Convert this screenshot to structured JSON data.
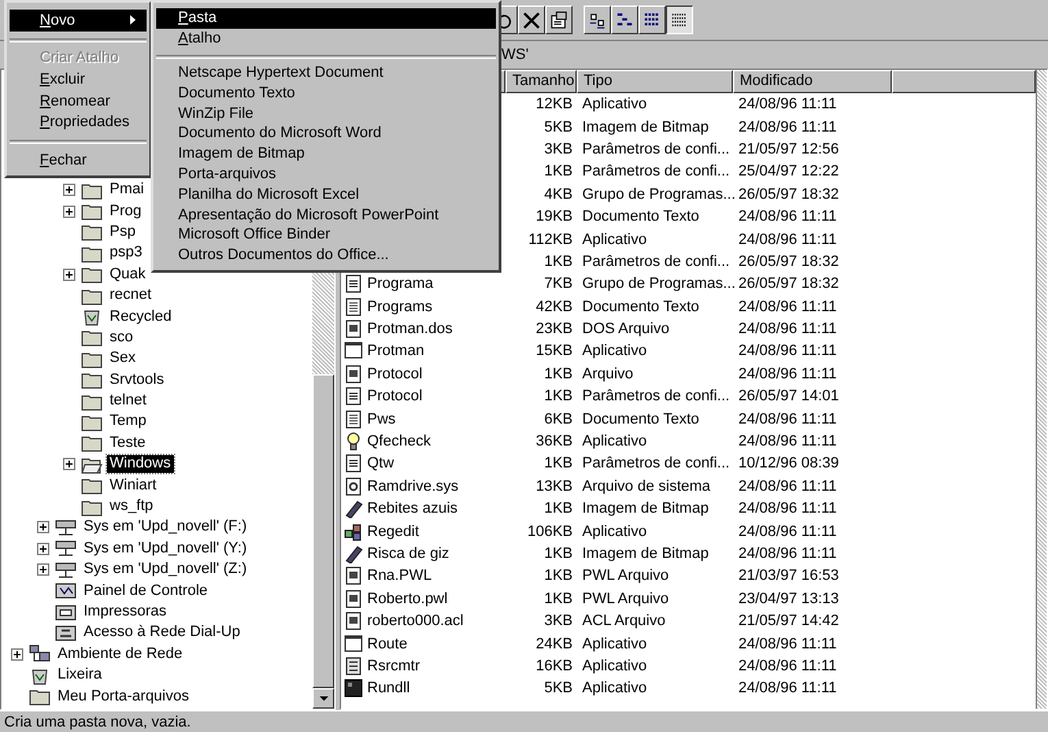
{
  "toolbar": {
    "buttons": [
      {
        "kind": "undo",
        "selected": false
      },
      {
        "kind": "delete",
        "selected": false
      },
      {
        "kind": "properties",
        "selected": false
      }
    ],
    "view_buttons": [
      {
        "kind": "large-icons",
        "selected": false
      },
      {
        "kind": "small-icons",
        "selected": false
      },
      {
        "kind": "list",
        "selected": false
      },
      {
        "kind": "details",
        "selected": true
      }
    ]
  },
  "caption": "WS'",
  "tree": [
    {
      "children": [
        {
          "children": [
            {
              "label": "Pmai",
              "kind": "folder",
              "expandable": true,
              "selected": false
            },
            {
              "label": "Prog",
              "kind": "folder",
              "expandable": true,
              "selected": false
            },
            {
              "label": "Psp",
              "kind": "folder",
              "expandable": false,
              "selected": false
            },
            {
              "label": "psp3",
              "kind": "folder",
              "expandable": false,
              "selected": false
            },
            {
              "label": "Quak",
              "kind": "folder",
              "expandable": true,
              "selected": false
            },
            {
              "label": "recnet",
              "kind": "folder",
              "expandable": false,
              "selected": false
            },
            {
              "label": "Recycled",
              "kind": "recycle",
              "expandable": false,
              "selected": false
            },
            {
              "label": "sco",
              "kind": "folder",
              "expandable": false,
              "selected": false
            },
            {
              "label": "Sex",
              "kind": "folder",
              "expandable": false,
              "selected": false
            },
            {
              "label": "Srvtools",
              "kind": "folder",
              "expandable": false,
              "selected": false
            },
            {
              "label": "telnet",
              "kind": "folder",
              "expandable": false,
              "selected": false
            },
            {
              "label": "Temp",
              "kind": "folder",
              "expandable": false,
              "selected": false
            },
            {
              "label": "Teste",
              "kind": "folder",
              "expandable": false,
              "selected": false
            },
            {
              "label": "Windows",
              "kind": "folder-open",
              "expandable": true,
              "selected": true
            },
            {
              "label": "Winiart",
              "kind": "folder",
              "expandable": false,
              "selected": false
            },
            {
              "label": "ws_ftp",
              "kind": "folder",
              "expandable": false,
              "selected": false
            }
          ]
        },
        {
          "label": "Sys em 'Upd_novell' (F:)",
          "kind": "netdrive",
          "expandable": true,
          "selected": false
        },
        {
          "label": "Sys em 'Upd_novell' (Y:)",
          "kind": "netdrive",
          "expandable": true,
          "selected": false
        },
        {
          "label": "Sys em 'Upd_novell' (Z:)",
          "kind": "netdrive",
          "expandable": true,
          "selected": false
        },
        {
          "label": "Painel de Controle",
          "kind": "panel",
          "expandable": false,
          "selected": false
        },
        {
          "label": "Impressoras",
          "kind": "printer",
          "expandable": false,
          "selected": false
        },
        {
          "label": "Acesso à Rede Dial-Up",
          "kind": "dialup",
          "expandable": false,
          "selected": false
        }
      ]
    },
    {
      "label": "Ambiente de Rede",
      "kind": "network",
      "expandable": true,
      "selected": false
    },
    {
      "label": "Lixeira",
      "kind": "recycle",
      "expandable": false,
      "selected": false
    },
    {
      "label": "Meu Porta-arquivos",
      "kind": "folder",
      "expandable": false,
      "selected": false
    }
  ],
  "columns": [
    "Tamanho",
    "Tipo",
    "Modificado"
  ],
  "rows": [
    {
      "size": "12KB",
      "type": "Aplicativo",
      "modified": "24/08/96 11:11"
    },
    {
      "size": "5KB",
      "type": "Imagem de Bitmap",
      "modified": "24/08/96 11:11"
    },
    {
      "size": "3KB",
      "type": "Parâmetros de confi...",
      "modified": "21/05/97 12:56"
    },
    {
      "size": "1KB",
      "type": "Parâmetros de confi...",
      "modified": "25/04/97 12:22"
    },
    {
      "size": "4KB",
      "type": "Grupo de Programas...",
      "modified": "26/05/97 18:32"
    },
    {
      "size": "19KB",
      "type": "Documento Texto",
      "modified": "24/08/96 11:11"
    },
    {
      "size": "112KB",
      "type": "Aplicativo",
      "modified": "24/08/96 11:11"
    },
    {
      "size": "1KB",
      "type": "Parâmetros de confi...",
      "modified": "26/05/97 18:32"
    },
    {
      "name": "Programa",
      "kind": "config",
      "size": "7KB",
      "type": "Grupo de Programas...",
      "modified": "26/05/97 18:32"
    },
    {
      "name": "Programs",
      "kind": "text",
      "size": "42KB",
      "type": "Documento Texto",
      "modified": "24/08/96 11:11"
    },
    {
      "name": "Protman.dos",
      "kind": "file",
      "size": "23KB",
      "type": "DOS Arquivo",
      "modified": "24/08/96 11:11"
    },
    {
      "name": "Protman",
      "kind": "window",
      "size": "15KB",
      "type": "Aplicativo",
      "modified": "24/08/96 11:11"
    },
    {
      "name": "Protocol",
      "kind": "file",
      "size": "1KB",
      "type": "Arquivo",
      "modified": "24/08/96 11:11"
    },
    {
      "name": "Protocol",
      "kind": "config",
      "size": "1KB",
      "type": "Parâmetros de confi...",
      "modified": "26/05/97 14:01"
    },
    {
      "name": "Pws",
      "kind": "text",
      "size": "6KB",
      "type": "Documento Texto",
      "modified": "24/08/96 11:11"
    },
    {
      "name": "Qfecheck",
      "kind": "bulb",
      "size": "36KB",
      "type": "Aplicativo",
      "modified": "24/08/96 11:11"
    },
    {
      "name": "Qtw",
      "kind": "config",
      "size": "1KB",
      "type": "Parâmetros de confi...",
      "modified": "10/12/96 08:39"
    },
    {
      "name": "Ramdrive.sys",
      "kind": "system",
      "size": "13KB",
      "type": "Arquivo de sistema",
      "modified": "24/08/96 11:11"
    },
    {
      "name": "Rebites azuis",
      "kind": "paint",
      "size": "1KB",
      "type": "Imagem de Bitmap",
      "modified": "24/08/96 11:11"
    },
    {
      "name": "Regedit",
      "kind": "regedit",
      "size": "106KB",
      "type": "Aplicativo",
      "modified": "24/08/96 11:11"
    },
    {
      "name": "Risca de giz",
      "kind": "paint",
      "size": "1KB",
      "type": "Imagem de Bitmap",
      "modified": "24/08/96 11:11"
    },
    {
      "name": "Rna.PWL",
      "kind": "file",
      "size": "1KB",
      "type": "PWL Arquivo",
      "modified": "21/03/97 16:53"
    },
    {
      "name": "Roberto.pwl",
      "kind": "file",
      "size": "1KB",
      "type": "PWL Arquivo",
      "modified": "23/04/97 13:13"
    },
    {
      "name": "roberto000.acl",
      "kind": "file",
      "size": "3KB",
      "type": "ACL Arquivo",
      "modified": "21/05/97 14:42"
    },
    {
      "name": "Route",
      "kind": "window",
      "size": "24KB",
      "type": "Aplicativo",
      "modified": "24/08/96 11:11"
    },
    {
      "name": "Rsrcmtr",
      "kind": "listwin",
      "size": "16KB",
      "type": "Aplicativo",
      "modified": "24/08/96 11:11"
    },
    {
      "name": "Rundll",
      "kind": "dark",
      "size": "5KB",
      "type": "Aplicativo",
      "modified": "24/08/96 11:11"
    }
  ],
  "status_bar": "Cria uma pasta nova, vazia.",
  "file_menu": [
    {
      "kind": "item",
      "label": "Novo",
      "mnemonic": true,
      "has_submenu": true,
      "selected": true,
      "disabled": false
    },
    {
      "kind": "separator"
    },
    {
      "kind": "item",
      "label": "Criar Atalho",
      "mnemonic": false,
      "has_submenu": false,
      "selected": false,
      "disabled": true
    },
    {
      "kind": "item",
      "label": "Excluir",
      "mnemonic": true,
      "has_submenu": false,
      "selected": false,
      "disabled": false
    },
    {
      "kind": "item",
      "label": "Renomear",
      "mnemonic": true,
      "has_submenu": false,
      "selected": false,
      "disabled": false
    },
    {
      "kind": "item",
      "label": "Propriedades",
      "mnemonic": true,
      "has_submenu": false,
      "selected": false,
      "disabled": false
    },
    {
      "kind": "separator"
    },
    {
      "kind": "item",
      "label": "Fechar",
      "mnemonic": true,
      "has_submenu": false,
      "selected": false,
      "disabled": false
    }
  ],
  "new_submenu": [
    {
      "kind": "item",
      "label": "Pasta",
      "mnemonic": true,
      "selected": true
    },
    {
      "kind": "item",
      "label": "Atalho",
      "mnemonic": true,
      "selected": false
    },
    {
      "kind": "separator"
    },
    {
      "kind": "item",
      "label": "Netscape Hypertext Document",
      "mnemonic": false,
      "selected": false
    },
    {
      "kind": "item",
      "label": "Documento Texto",
      "mnemonic": false,
      "selected": false
    },
    {
      "kind": "item",
      "label": "WinZip File",
      "mnemonic": false,
      "selected": false
    },
    {
      "kind": "item",
      "label": "Documento do Microsoft Word",
      "mnemonic": false,
      "selected": false
    },
    {
      "kind": "item",
      "label": "Imagem de Bitmap",
      "mnemonic": false,
      "selected": false
    },
    {
      "kind": "item",
      "label": "Porta-arquivos",
      "mnemonic": false,
      "selected": false
    },
    {
      "kind": "item",
      "label": "Planilha do Microsoft Excel",
      "mnemonic": false,
      "selected": false
    },
    {
      "kind": "item",
      "label": "Apresentação do Microsoft PowerPoint",
      "mnemonic": false,
      "selected": false
    },
    {
      "kind": "item",
      "label": "Microsoft Office Binder",
      "mnemonic": false,
      "selected": false
    },
    {
      "kind": "item",
      "label": "Outros Documentos do Office...",
      "mnemonic": false,
      "selected": false
    }
  ]
}
